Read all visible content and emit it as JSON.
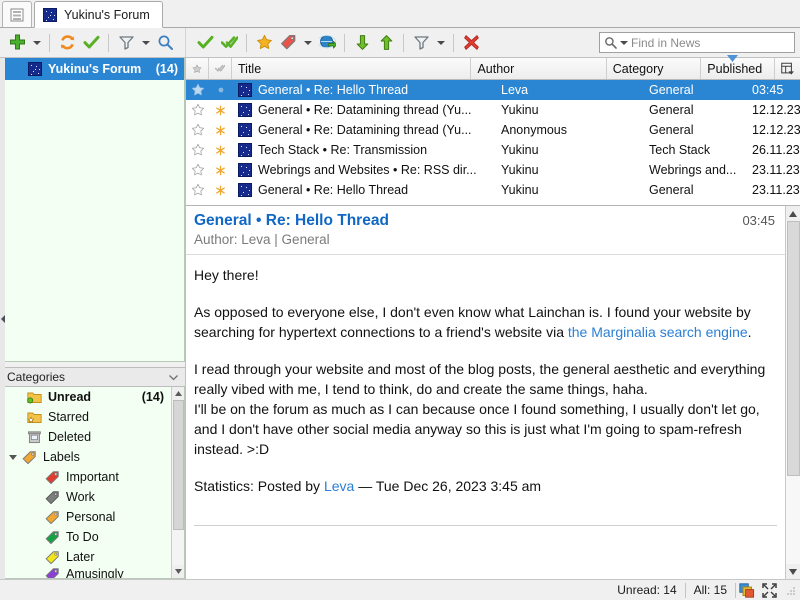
{
  "window": {
    "tab_list_icon": "feed-list-icon",
    "active_tab": {
      "label": "Yukinu's Forum",
      "favicon": "starfield-favicon"
    }
  },
  "toolbar_left": {
    "buttons": [
      {
        "name": "add-feed-button",
        "icon": "plus-icon",
        "label": "Add"
      },
      {
        "name": "add-feed-dropdown",
        "icon": "chevron-down-icon",
        "label": ""
      },
      {
        "name": "update-all-button",
        "icon": "refresh-icon",
        "label": "Update all feeds"
      },
      {
        "name": "mark-read-button",
        "icon": "check-icon",
        "label": "Mark read"
      },
      {
        "name": "feed-filter-button",
        "icon": "funnel-icon",
        "label": "Filter feeds"
      },
      {
        "name": "feed-filter-dropdown",
        "icon": "chevron-down-icon",
        "label": ""
      },
      {
        "name": "search-feeds-button",
        "icon": "magnifier-icon",
        "label": "Search feeds"
      }
    ]
  },
  "toolbar_right": {
    "buttons": [
      {
        "name": "mark-read-button",
        "icon": "check-icon",
        "label": "Mark selected as read"
      },
      {
        "name": "mark-all-read-button",
        "icon": "double-check-icon",
        "label": "Mark all as read"
      },
      {
        "name": "star-button",
        "icon": "star-icon",
        "label": "Switch importance"
      },
      {
        "name": "label-button",
        "icon": "tag-icon",
        "label": "Assign label"
      },
      {
        "name": "label-dropdown",
        "icon": "chevron-down-icon",
        "label": ""
      },
      {
        "name": "open-in-browser-button",
        "icon": "globe-arrow-icon",
        "label": "Open in browser"
      },
      {
        "name": "move-down-button",
        "icon": "arrow-down-icon",
        "label": "Next unread"
      },
      {
        "name": "move-up-button",
        "icon": "arrow-up-icon",
        "label": "Previous unread"
      },
      {
        "name": "message-filter-button",
        "icon": "funnel-icon",
        "label": "Filter messages"
      },
      {
        "name": "message-filter-dropdown",
        "icon": "chevron-down-icon",
        "label": ""
      },
      {
        "name": "delete-button",
        "icon": "delete-x-icon",
        "label": "Delete selected"
      }
    ]
  },
  "search": {
    "icon": "search-dropdown-icon",
    "placeholder": "Find in News",
    "value": ""
  },
  "feeds": {
    "items": [
      {
        "label": "Yukinu's Forum",
        "count": "(14)",
        "selected": true,
        "favicon": "starfield-favicon"
      }
    ]
  },
  "categories": {
    "header": "Categories",
    "collapse_icon": "chevron-down-icon",
    "items": [
      {
        "label": "Unread",
        "count": "(14)",
        "icon": "folder-unread-icon",
        "indent": 1,
        "bold": true
      },
      {
        "label": "Starred",
        "count": "",
        "icon": "folder-star-icon",
        "indent": 1,
        "bold": false
      },
      {
        "label": "Deleted",
        "count": "",
        "icon": "trash-icon",
        "indent": 1,
        "bold": false
      },
      {
        "label": "Labels",
        "count": "",
        "icon": "tag-icon",
        "indent": 1,
        "bold": false,
        "expander": true
      },
      {
        "label": "Important",
        "count": "",
        "icon": "tag-red-icon",
        "indent": 2,
        "bold": false
      },
      {
        "label": "Work",
        "count": "",
        "icon": "tag-gray-icon",
        "indent": 2,
        "bold": false
      },
      {
        "label": "Personal",
        "count": "",
        "icon": "tag-orange-icon",
        "indent": 2,
        "bold": false
      },
      {
        "label": "To Do",
        "count": "",
        "icon": "tag-green-icon",
        "indent": 2,
        "bold": false
      },
      {
        "label": "Later",
        "count": "",
        "icon": "tag-yellow-icon",
        "indent": 2,
        "bold": false
      },
      {
        "label": "Amusingly",
        "count": "",
        "icon": "tag-purple-icon",
        "indent": 2,
        "bold": false
      }
    ]
  },
  "message_list": {
    "columns": [
      {
        "key": "star",
        "label": "",
        "icon": "star-icon"
      },
      {
        "key": "read",
        "label": "",
        "icon": "double-check-icon"
      },
      {
        "key": "title",
        "label": "Title"
      },
      {
        "key": "author",
        "label": "Author"
      },
      {
        "key": "cat",
        "label": "Category"
      },
      {
        "key": "pub",
        "label": "Published",
        "sorted": "asc"
      },
      {
        "key": "config",
        "label": "",
        "icon": "column-config-icon"
      }
    ],
    "rows": [
      {
        "title": "General • Re: Hello Thread",
        "author": "Leva",
        "category": "General",
        "published": "03:45",
        "selected": true,
        "starred": true,
        "unread": false
      },
      {
        "title": "General • Re: Datamining thread (Yu...",
        "author": "Yukinu",
        "category": "General",
        "published": "12.12.23",
        "selected": false,
        "starred": false,
        "unread": true
      },
      {
        "title": "General • Re: Datamining thread (Yu...",
        "author": "Anonymous",
        "category": "General",
        "published": "12.12.23",
        "selected": false,
        "starred": false,
        "unread": true
      },
      {
        "title": "Tech Stack • Re: Transmission",
        "author": "Yukinu",
        "category": "Tech Stack",
        "published": "26.11.23",
        "selected": false,
        "starred": false,
        "unread": true
      },
      {
        "title": "Webrings and Websites • Re: RSS dir...",
        "author": "Yukinu",
        "category": "Webrings and...",
        "published": "23.11.23",
        "selected": false,
        "starred": false,
        "unread": true
      },
      {
        "title": "General • Re: Hello Thread",
        "author": "Yukinu",
        "category": "General",
        "published": "23.11.23",
        "selected": false,
        "starred": false,
        "unread": true
      }
    ]
  },
  "article": {
    "title": "General • Re: Hello Thread",
    "time": "03:45",
    "meta": "Author: Leva | General",
    "paragraphs": [
      {
        "text": "Hey there!"
      },
      {
        "text_before": "As opposed to everyone else, I don't even know what Lainchan is. I found your website by searching for hypertext connections to a friend's website via ",
        "link": "the Marginalia search engine",
        "text_after": "."
      },
      {
        "text": "I read through your website and most of the blog posts, the general aesthetic and everything really vibed with me, I tend to think, do and create the same things, haha."
      },
      {
        "text": "I'll be on the forum as much as I can because once I found something, I usually don't let go, and I don't have other social media anyway so this is just what I'm going to spam-refresh instead. >:D"
      }
    ],
    "statistics_prefix": "Statistics: Posted by ",
    "statistics_author": "Leva",
    "statistics_suffix": " — Tue Dec 26, 2023 3:45 am"
  },
  "statusbar": {
    "unread": "Unread: 14",
    "all": "All: 15",
    "buttons": [
      {
        "name": "feed-download-progress-icon",
        "icon": "stacked-squares-icon"
      },
      {
        "name": "fullscreen-button",
        "icon": "fullscreen-icon"
      }
    ]
  },
  "colors": {
    "selection": "#2a86d3",
    "link": "#2a7fd4",
    "title_link": "#1168c4",
    "sidebar_bg": "#f4fff4",
    "favicon_blue": "#152a8c"
  }
}
